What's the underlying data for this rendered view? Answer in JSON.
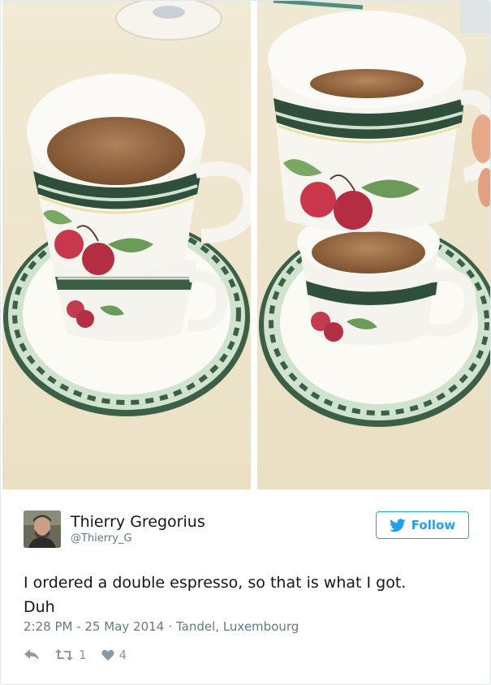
{
  "tweet": {
    "author": {
      "display_name": "Thierry Gregorius",
      "handle": "@Thierry_G"
    },
    "follow_label": "Follow",
    "text_line1": "I ordered a double espresso, so that is what I got.",
    "text_line2": "Duh",
    "time": "2:28 PM - 25 May 2014",
    "location": "Tandel, Luxembourg",
    "meta_separator": "·",
    "retweet_count": "1",
    "like_count": "4"
  },
  "colors": {
    "accent": "#1da1f2",
    "text": "#14171a",
    "muted": "#657786",
    "action_icon": "#8899a6"
  },
  "icons": {
    "follow": "twitter-bird-icon",
    "reply": "reply-icon",
    "retweet": "retweet-icon",
    "like": "heart-icon"
  }
}
